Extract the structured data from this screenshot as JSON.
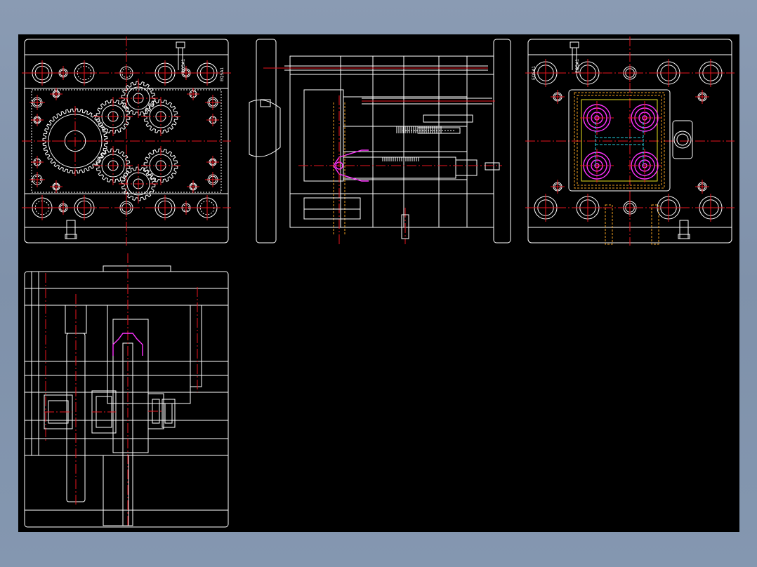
{
  "colors": {
    "background": "#000000",
    "window": "#8a9bb3",
    "outline": "#ffffff",
    "centerline": "#e8141e",
    "part": "#ff33ff",
    "hidden_orange": "#f0a020",
    "hidden_cyan": "#22d0e0"
  },
  "views": {
    "top_left": {
      "tag_a": "EQ5A1",
      "tag_b": "EQ5A1"
    },
    "side": {},
    "top_right": {
      "tag_a": "EQ5A1",
      "tag_b": "EQ5A1"
    },
    "section": {}
  }
}
